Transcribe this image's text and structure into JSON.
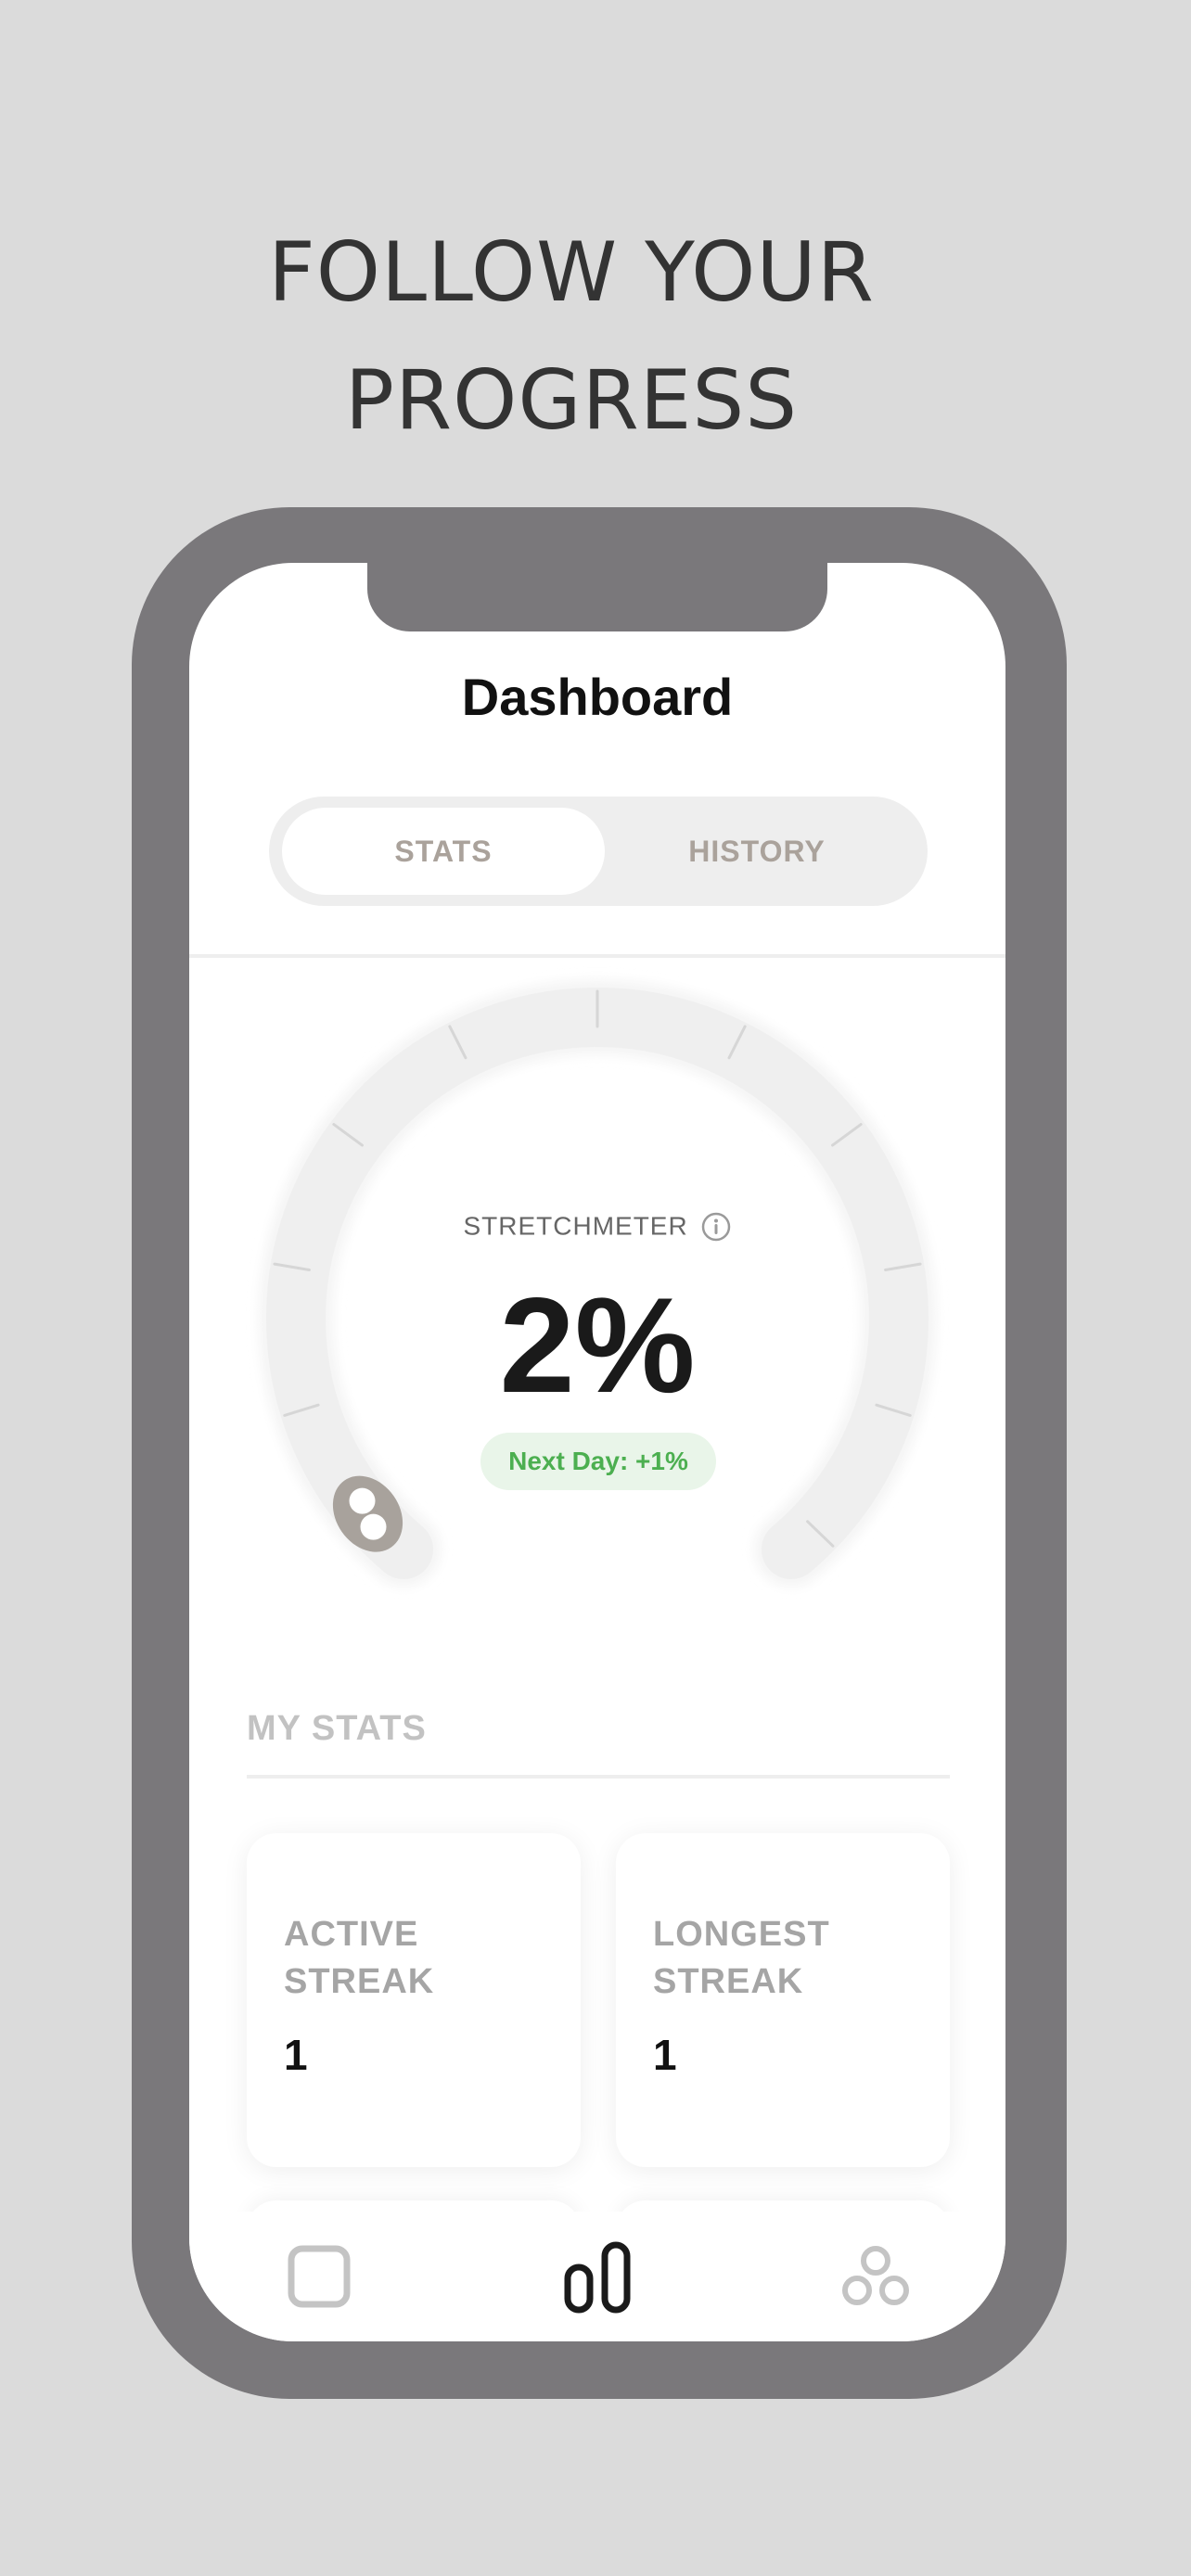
{
  "promo": {
    "headline_line1": "FOLLOW YOUR",
    "headline_line2": "PROGRESS"
  },
  "header": {
    "title": "Dashboard"
  },
  "tabs": {
    "stats": "STATS",
    "history": "HISTORY",
    "active": "stats"
  },
  "meter": {
    "label": "STRETCHMETER",
    "value": "2%",
    "progress_fraction": 0.02,
    "next_day": "Next Day: +1%",
    "info_icon": "info-icon"
  },
  "my_stats": {
    "title": "MY STATS",
    "cards": [
      {
        "label_line1": "ACTIVE",
        "label_line2": "STREAK",
        "value": "1"
      },
      {
        "label_line1": "LONGEST",
        "label_line2": "STREAK",
        "value": "1"
      }
    ]
  },
  "tabbar": {
    "items": [
      {
        "icon": "square-icon",
        "active": false
      },
      {
        "icon": "bar-chart-icon",
        "active": true
      },
      {
        "icon": "circles-icon",
        "active": false
      }
    ]
  },
  "colors": {
    "background": "#dbdbdb",
    "phone_frame": "#7a787b",
    "accent_green": "#4caf50",
    "gauge_track": "#efefef",
    "handle": "#a8a29c",
    "muted_text": "#a5a5a5"
  }
}
